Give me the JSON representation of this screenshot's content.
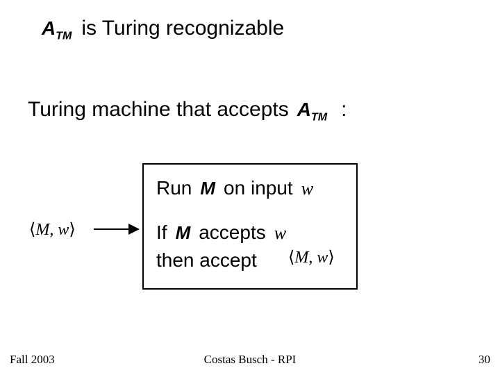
{
  "title": {
    "atm_main": "A",
    "atm_sub": "TM",
    "text": "is Turing recognizable"
  },
  "subtitle": {
    "text": "Turing machine that accepts",
    "atm_main": "A",
    "atm_sub": "TM",
    "colon": ":"
  },
  "box": {
    "run": "Run",
    "on_input": "on input",
    "if": "If",
    "accepts": "accepts",
    "then_accept": "then accept"
  },
  "symbols": {
    "M": "M",
    "w": "w",
    "pair_open": "⟨",
    "pair_mid": ",",
    "pair_close": "⟩"
  },
  "footer": {
    "left": "Fall 2003",
    "center": "Costas Busch - RPI",
    "right": "30"
  }
}
